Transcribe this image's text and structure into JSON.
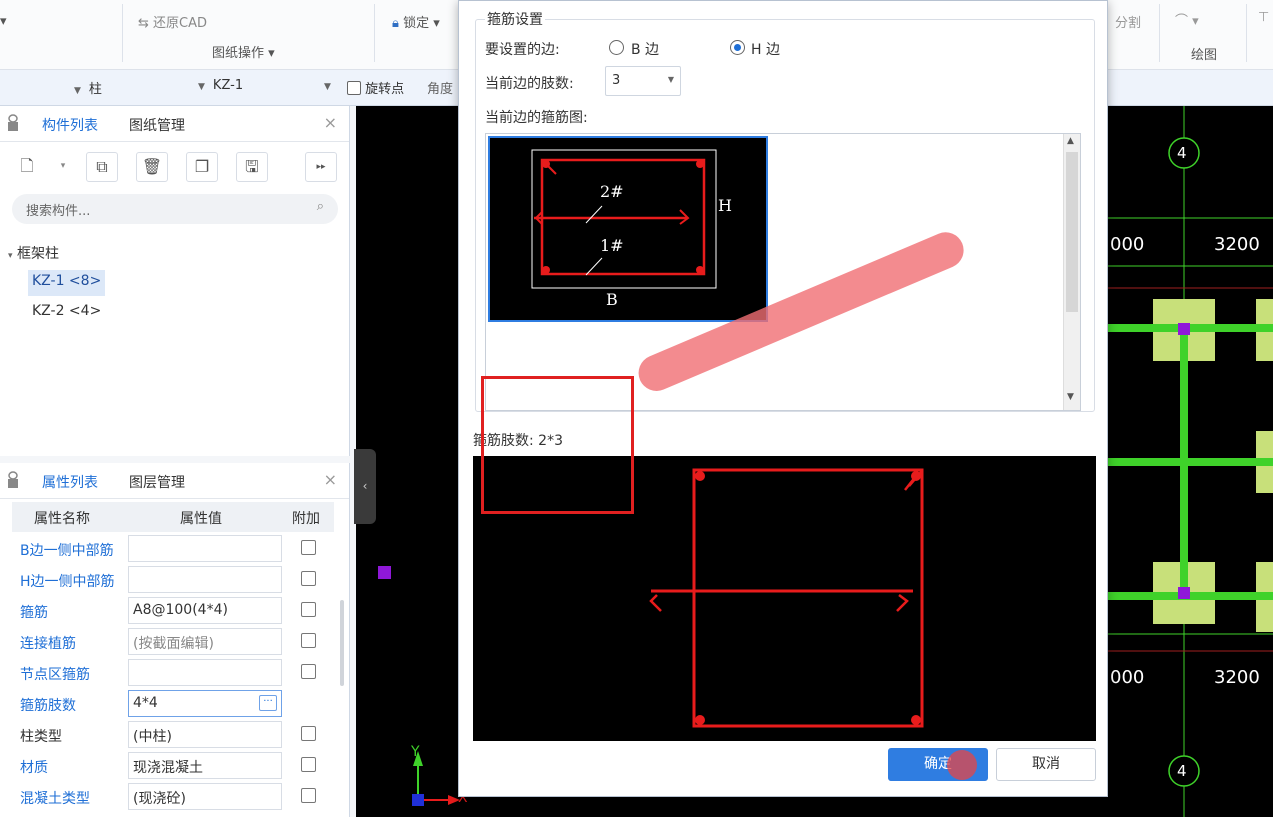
{
  "ribbon": {
    "restore_cad": "还原CAD",
    "drawing_ops": "图纸操作",
    "lock": "锁定",
    "split": "分割",
    "draw": "绘图"
  },
  "selector_bar": {
    "category": "柱",
    "item": "KZ-1",
    "rotate_point": "旋转点",
    "angle": "角度"
  },
  "component_panel": {
    "tabs": [
      "构件列表",
      "图纸管理"
    ],
    "search_placeholder": "搜索构件...",
    "tree_root": "框架柱",
    "items": [
      "KZ-1 <8>",
      "KZ-2 <4>"
    ]
  },
  "property_panel": {
    "tabs": [
      "属性列表",
      "图层管理"
    ],
    "headers": [
      "属性名称",
      "属性值",
      "附加"
    ],
    "rows": [
      {
        "name": "B边一侧中部筋",
        "value": "",
        "blue": true
      },
      {
        "name": "H边一侧中部筋",
        "value": "",
        "blue": true
      },
      {
        "name": "箍筋",
        "value": "A8@100(4*4)",
        "blue": true
      },
      {
        "name": "连接植筋",
        "value": "(按截面编辑)",
        "blue": true
      },
      {
        "name": "节点区箍筋",
        "value": "",
        "blue": true
      },
      {
        "name": "箍筋肢数",
        "value": "4*4",
        "blue": true
      },
      {
        "name": "柱类型",
        "value": "(中柱)",
        "blue": false
      },
      {
        "name": "材质",
        "value": "现浇混凝土",
        "blue": true
      },
      {
        "name": "混凝土类型",
        "value": "(现浇砼)",
        "blue": true
      }
    ]
  },
  "cad": {
    "axis_label": "4",
    "dims": [
      "000",
      "3200",
      "000",
      "3200"
    ],
    "y_axis": "Y",
    "x_axis": "X"
  },
  "dialog": {
    "group_title": "箍筋设置",
    "side_label": "要设置的边:",
    "side_b": "B 边",
    "side_h": "H 边",
    "leg_count_label": "当前边的肢数:",
    "leg_count_value": "3",
    "current_diagram_label": "当前边的箍筋图:",
    "thumb": {
      "mark_top": "2#",
      "mark_bottom": "1#",
      "h": "H",
      "b": "B"
    },
    "total_label": "箍筋肢数: 2*3",
    "ok": "确定",
    "cancel": "取消"
  },
  "colors": {
    "accent": "#1f6fd6",
    "rebar_red": "#e81c1c",
    "beam_green": "#3fd22a",
    "column_fill": "#c8e07a",
    "node_purple": "#8f18d8"
  }
}
